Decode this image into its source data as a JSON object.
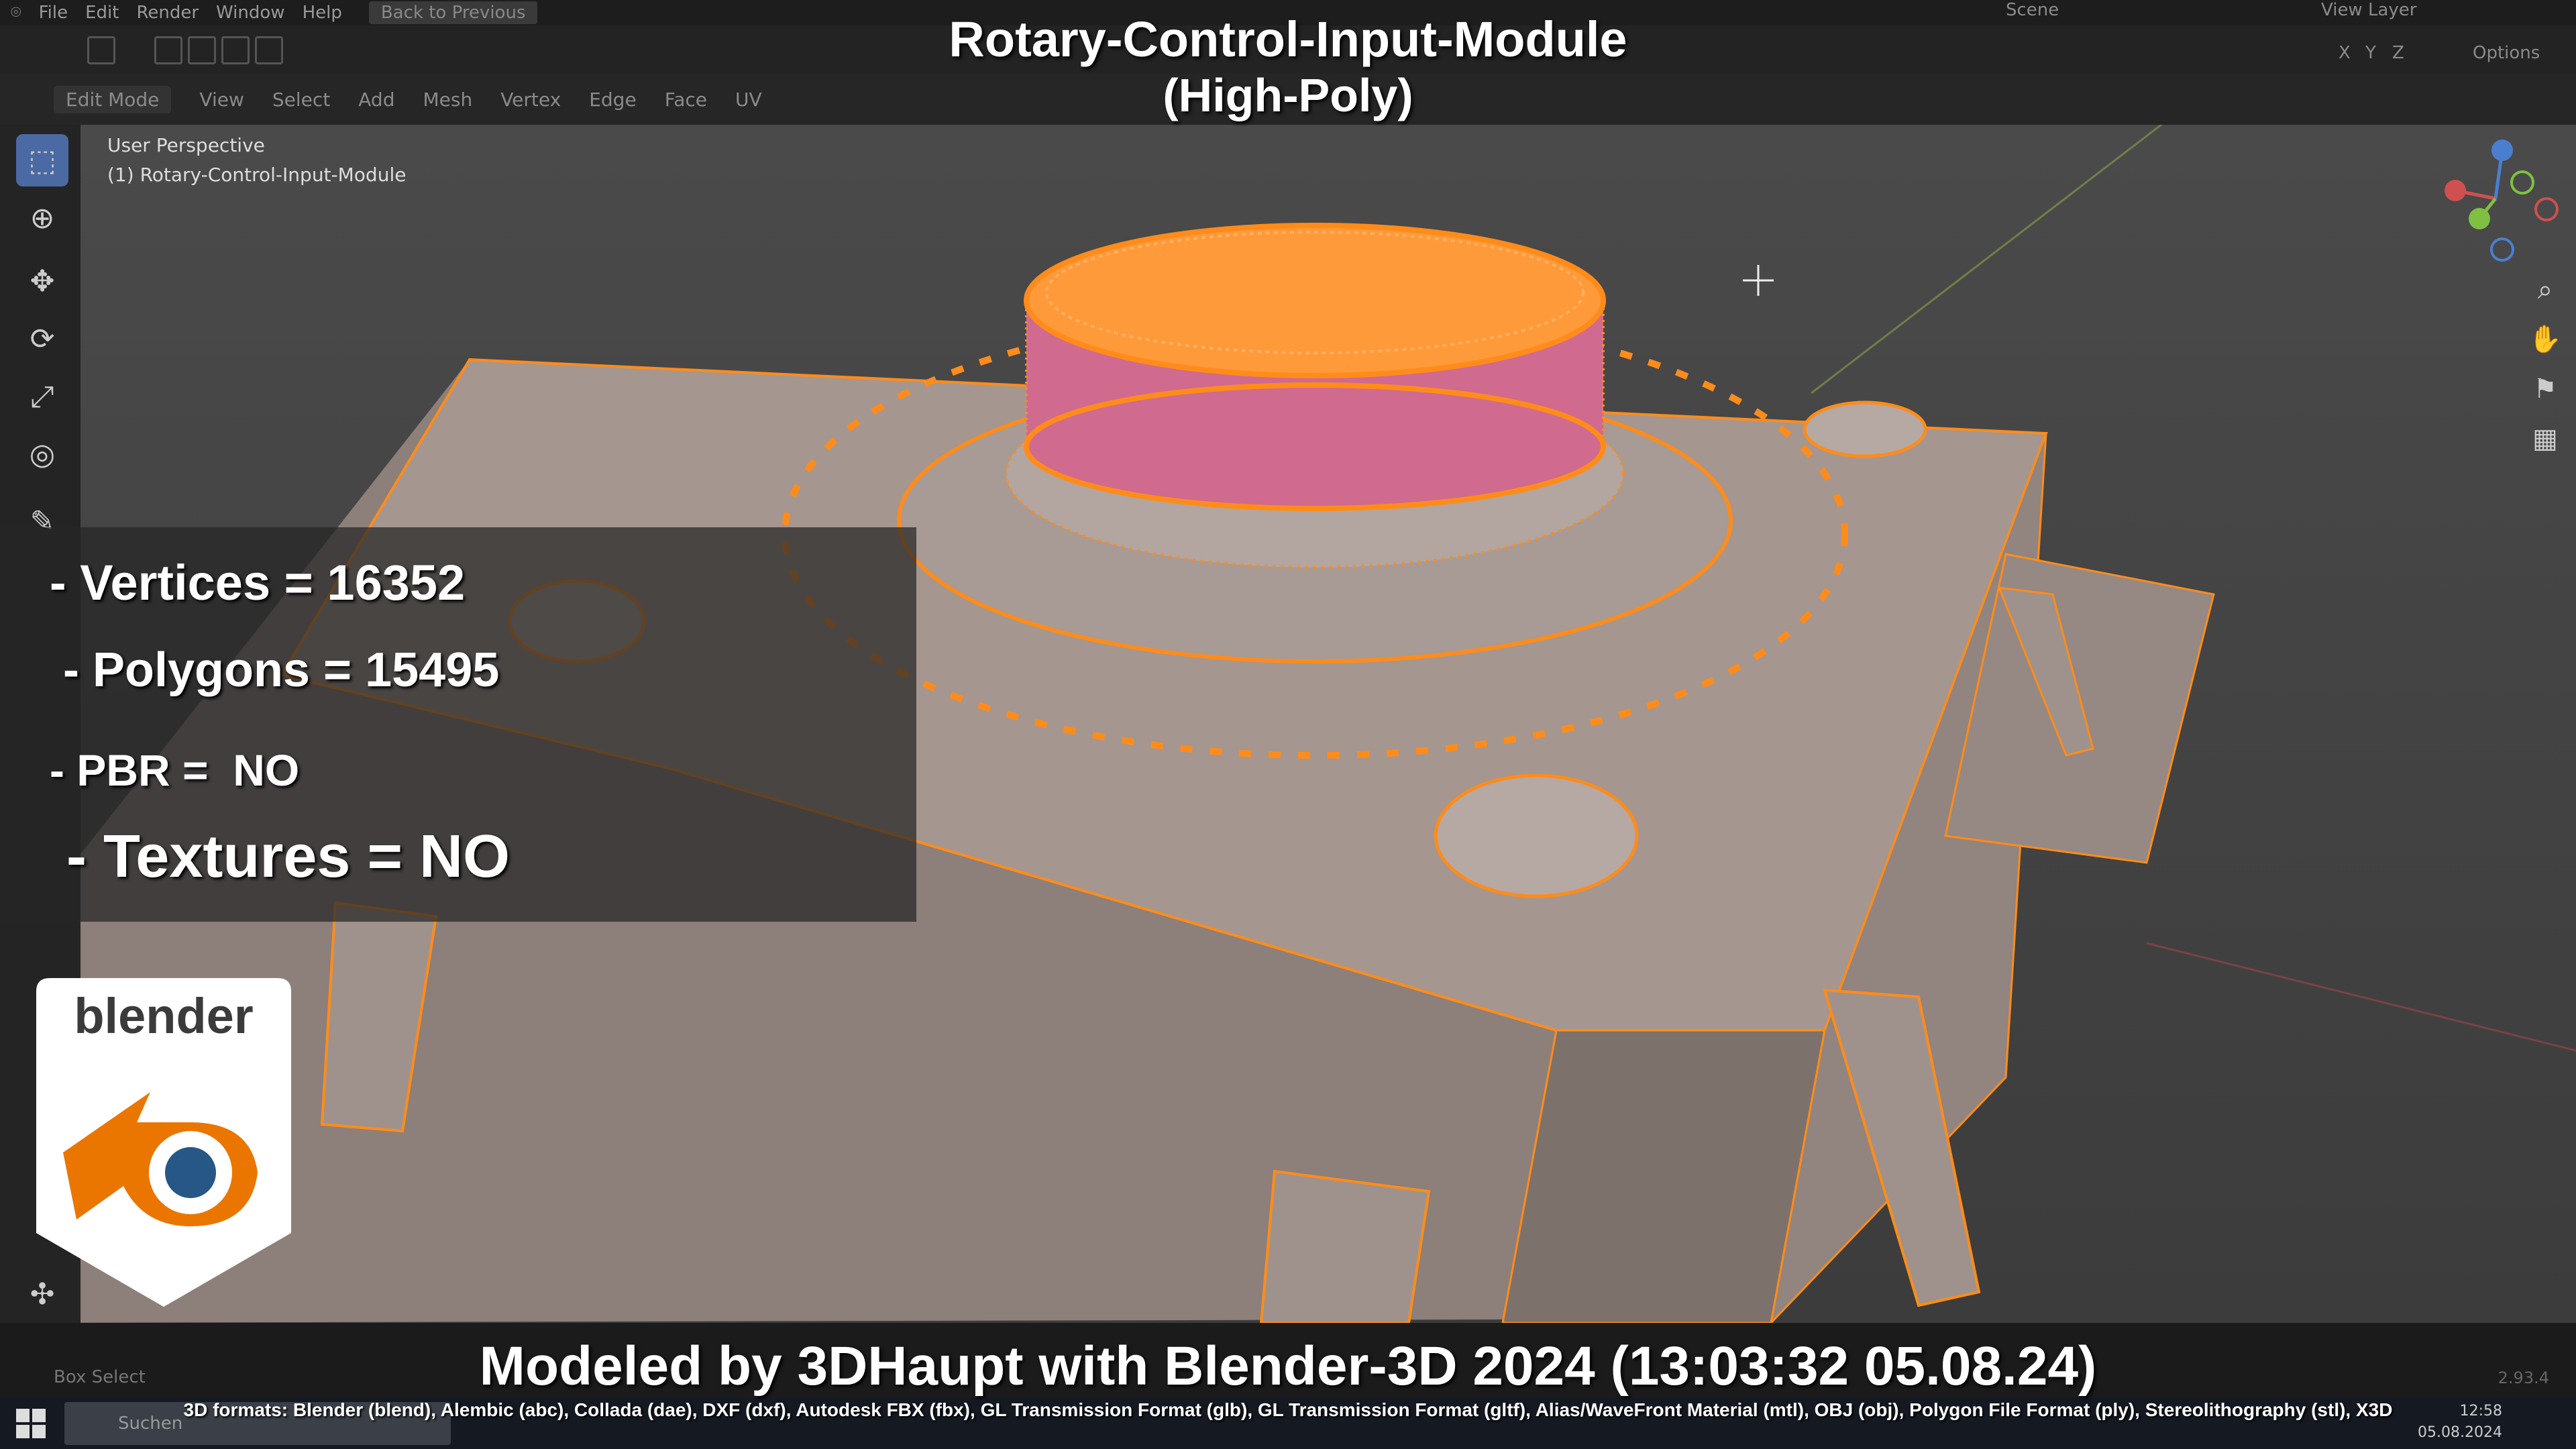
{
  "menu": [
    "File",
    "Edit",
    "Render",
    "Window",
    "Help"
  ],
  "back_to_previous": "Back to Previous",
  "scene_label": "Scene",
  "view_layer_label": "View Layer",
  "options_label": "Options",
  "header": {
    "mode": "Edit Mode",
    "items": [
      "View",
      "Select",
      "Add",
      "Mesh",
      "Vertex",
      "Edge",
      "Face",
      "UV"
    ],
    "axes": [
      "X",
      "Y",
      "Z"
    ]
  },
  "viewport": {
    "perspective": "User Perspective",
    "object": "(1) Rotary-Control-Input-Module"
  },
  "title": {
    "line1": "Rotary-Control-Input-Module",
    "line2": "(High-Poly)"
  },
  "stats": {
    "vertices": "- Vertices = 16352",
    "polygons": " - Polygons = 15495",
    "pbr": "- PBR =  NO",
    "textures": " - Textures = NO"
  },
  "logo_text": "blender",
  "credit": "Modeled by 3DHaupt with Blender-3D 2024 (13:03:32  05.08.24)",
  "formats": "3D formats: Blender (blend), Alembic (abc), Collada (dae), DXF (dxf), Autodesk FBX (fbx), GL Transmission Format (glb), GL Transmission Format (gltf), Alias/WaveFront Material (mtl), OBJ (obj), Polygon File Format (ply), Stereolithography (stl), X3D",
  "statusbar": {
    "box_select": "Box Select",
    "version": "2.93.4"
  },
  "taskbar": {
    "search": "Suchen",
    "time": "12:58",
    "date": "05.08.2024"
  },
  "colors": {
    "selection_orange": "#ff8c1a",
    "mesh_gray": "#a99a94",
    "active_tool_blue": "#4b6aa3",
    "logo_blue": "#265787"
  }
}
